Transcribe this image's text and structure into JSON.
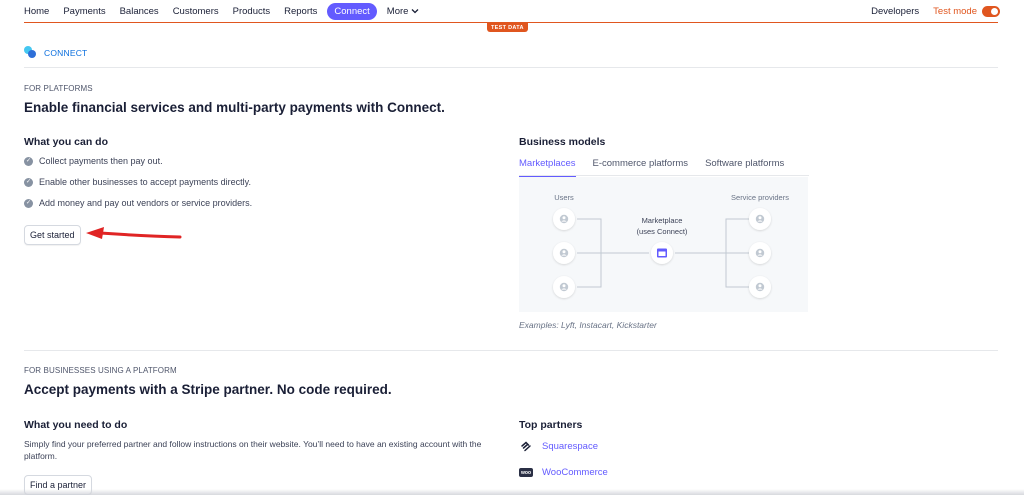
{
  "nav": {
    "items": [
      "Home",
      "Payments",
      "Balances",
      "Customers",
      "Products",
      "Reports"
    ],
    "active": "Connect",
    "more": "More",
    "developers": "Developers",
    "test_mode": "Test mode",
    "test_badge": "TEST DATA"
  },
  "connect": {
    "label": "CONNECT"
  },
  "platforms": {
    "eyebrow": "FOR PLATFORMS",
    "title": "Enable financial services and multi-party payments with Connect.",
    "what_heading": "What you can do",
    "features": [
      "Collect payments then pay out.",
      "Enable other businesses to accept payments directly.",
      "Add money and pay out vendors or service providers."
    ],
    "cta": "Get started",
    "models_heading": "Business models",
    "tabs": [
      "Marketplaces",
      "E-commerce platforms",
      "Software platforms"
    ],
    "diagram": {
      "users_label": "Users",
      "providers_label": "Service providers",
      "center_line1": "Marketplace",
      "center_line2": "(uses Connect)"
    },
    "examples": "Examples: Lyft, Instacart, Kickstarter"
  },
  "businesses": {
    "eyebrow": "FOR BUSINESSES USING A PLATFORM",
    "title": "Accept payments with a Stripe partner. No code required.",
    "need_heading": "What you need to do",
    "description": "Simply find your preferred partner and follow instructions on their website. You’ll need to have an existing account with the platform.",
    "cta": "Find a partner",
    "partners_heading": "Top partners",
    "partners": [
      "Squarespace",
      "WooCommerce"
    ]
  },
  "colors": {
    "accent": "#635bff",
    "test_mode": "#e0561f",
    "link": "#0a6ede"
  },
  "icons": {
    "check": "check-circle-icon",
    "user": "user-icon",
    "store": "storefront-icon",
    "chevron": "chevron-down-icon",
    "connect_logo": "connect-logo-icon",
    "squarespace": "squarespace-icon",
    "woocommerce": "woocommerce-icon"
  }
}
